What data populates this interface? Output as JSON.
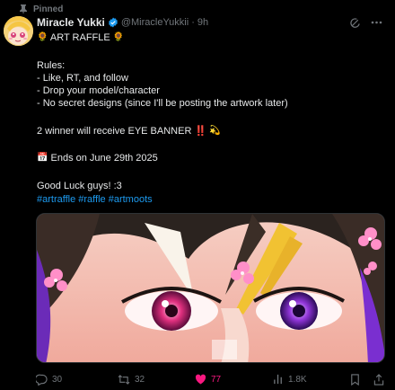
{
  "pinned": {
    "label": "Pinned"
  },
  "author": {
    "name": "Miracle Yukki",
    "handle": "@MiracleYukkii",
    "separator": "·",
    "time": "9h"
  },
  "tweet": {
    "title_text": " ART RAFFLE ",
    "title_emoji": "🌻",
    "lines": [
      "Rules:",
      "- Like, RT, and follow",
      "- Drop your model/character",
      "- No secret designs (since I'll be posting the artwork later)"
    ],
    "winner_line": "2 winner will receive EYE BANNER ‼️",
    "winner_emoji": "💫",
    "ends_emoji": "📅",
    "ends_text": " Ends on June 29th 2025",
    "good_luck": "Good Luck guys! :3",
    "hashtags": [
      "#artraffle",
      "#raffle",
      "#artmoots"
    ]
  },
  "metrics": {
    "replies": "30",
    "reposts": "32",
    "likes": "77",
    "views": "1.8K"
  },
  "colors": {
    "background": "#000000",
    "text": "#e7e9ea",
    "muted": "#71767b",
    "link": "#1d9bf0",
    "like": "#f91880",
    "verified": "#1d9bf0"
  },
  "icons": {
    "pin": "pin-icon",
    "verified": "verified-badge-icon",
    "grok": "grok-icon",
    "more": "more-icon",
    "reply": "reply-icon",
    "repost": "repost-icon",
    "like": "heart-icon",
    "views": "views-icon",
    "bookmark": "bookmark-icon",
    "share": "share-icon"
  }
}
